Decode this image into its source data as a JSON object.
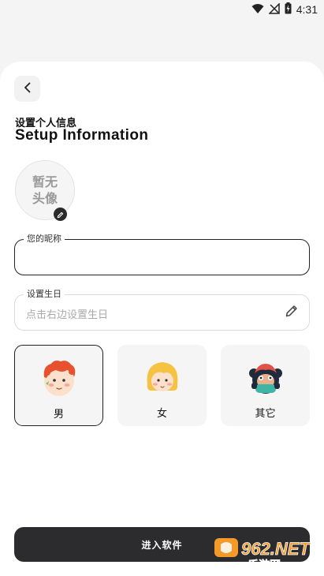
{
  "status_bar": {
    "time": "4:31",
    "icons": [
      "wifi-icon",
      "signal-off-icon",
      "battery-charging-icon"
    ]
  },
  "header": {
    "back_icon": "chevron-left-icon",
    "title_cn": "设置个人信息",
    "title_en": "Setup Information"
  },
  "avatar": {
    "text": "暂无头像",
    "edit_icon": "pencil-icon"
  },
  "form": {
    "nickname": {
      "legend": "您的昵称",
      "value": ""
    },
    "birthday": {
      "legend": "设置生日",
      "placeholder": "点击右边设置生日",
      "edit_icon": "pencil-icon"
    }
  },
  "gender": {
    "options": [
      {
        "label": "男",
        "icon": "boy-avatar-icon",
        "selected": true
      },
      {
        "label": "女",
        "icon": "girl-avatar-icon",
        "selected": false
      },
      {
        "label": "其它",
        "icon": "monster-avatar-icon",
        "selected": false
      }
    ]
  },
  "actions": {
    "enter_label": "进入软件"
  },
  "watermark": {
    "brand": "962.NET",
    "subtitle": "乐游网"
  },
  "colors": {
    "background": "#f4f4f4",
    "card": "#ffffff",
    "primary_button": "#2c2c2e",
    "selected_border": "#222222",
    "watermark_orange": "#f39a2b"
  }
}
